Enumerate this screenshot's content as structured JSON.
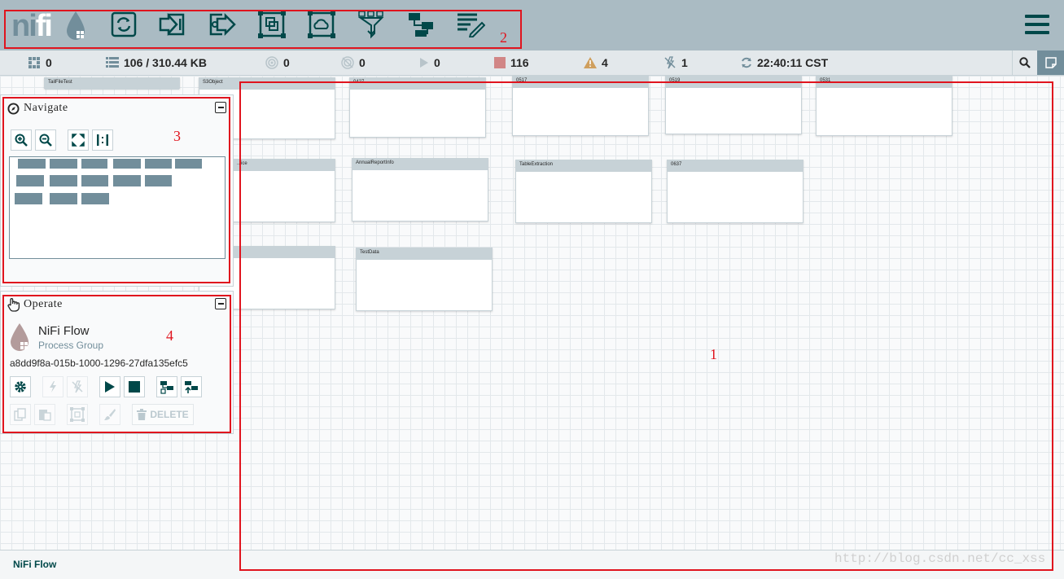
{
  "header": {
    "logo_prefix": "ni",
    "logo_suffix": "fi",
    "toolbar_icons": [
      "processor-icon",
      "input-port-icon",
      "output-port-icon",
      "process-group-icon",
      "remote-process-group-icon",
      "funnel-icon",
      "template-icon",
      "label-icon"
    ],
    "menu_icon": "hamburger-menu-icon"
  },
  "status": {
    "transmitting": "0",
    "queued": "106 / 310.44 KB",
    "transmitting_remote": "0",
    "not_transmitting_remote": "0",
    "running": "0",
    "stopped": "116",
    "invalid": "4",
    "disabled": "1",
    "last_refresh": "22:40:11 CST"
  },
  "canvas": {
    "process_groups": [
      {
        "name": "TailFileTest"
      },
      {
        "name": "S3Object"
      },
      {
        "name": "0427"
      },
      {
        "name": "0517"
      },
      {
        "name": "0519"
      },
      {
        "name": "0531"
      },
      {
        "name": "...ice"
      },
      {
        "name": "AnnualReportInfo"
      },
      {
        "name": "TableExtraction"
      },
      {
        "name": "0637"
      },
      {
        "name": ""
      },
      {
        "name": "TestData"
      }
    ]
  },
  "navigate": {
    "title": "Navigate",
    "buttons": [
      "zoom-in-icon",
      "zoom-out-icon",
      "fit-icon",
      "actual-size-icon"
    ]
  },
  "operate": {
    "title": "Operate",
    "name": "NiFi Flow",
    "type": "Process Group",
    "id": "a8dd9f8a-015b-1000-1296-27dfa135efc5",
    "delete_label": "DELETE"
  },
  "annotations": {
    "n1": "1",
    "n2": "2",
    "n3": "3",
    "n4": "4"
  },
  "footer": {
    "breadcrumb": "NiFi Flow",
    "watermark": "http://blog.csdn.net/cc_xss"
  },
  "colors": {
    "toolbar_bg": "#aabbc3",
    "icon_dark": "#004849",
    "accent": "#728e9b",
    "stopped": "#d18686",
    "invalid": "#cf9f5d",
    "annotation_red": "#e0141e"
  }
}
